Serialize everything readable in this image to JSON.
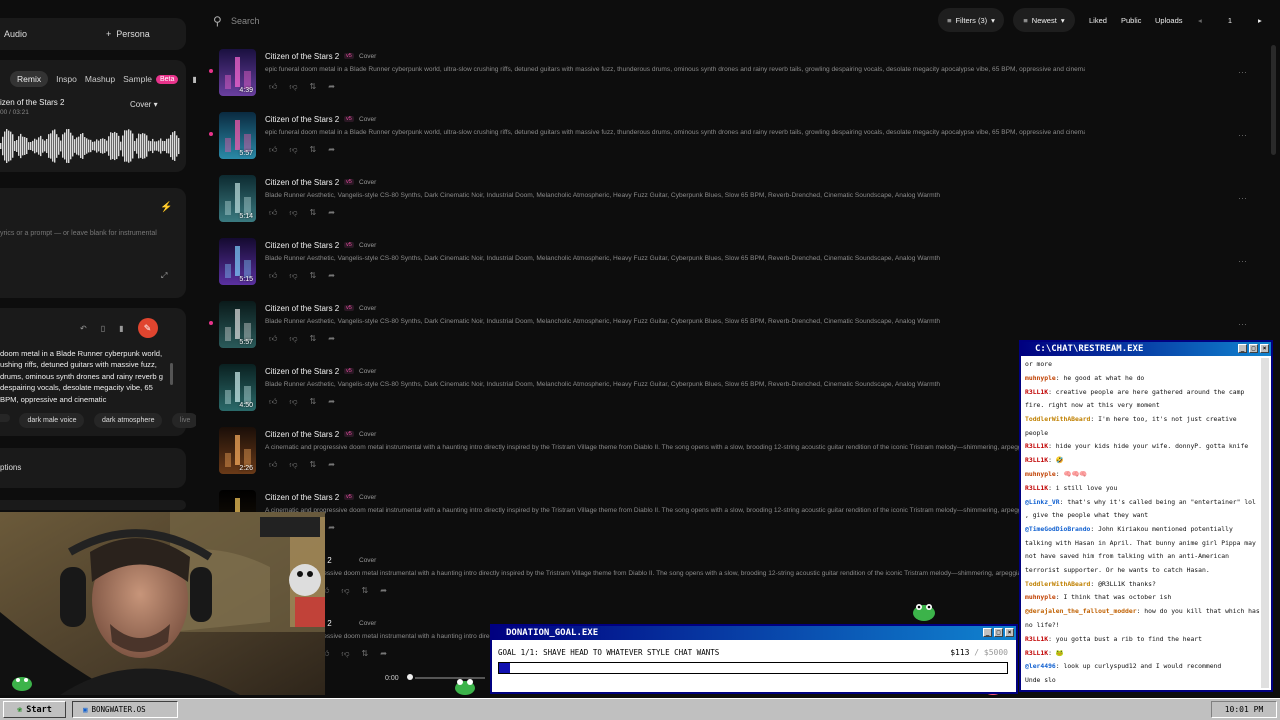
{
  "left": {
    "audio_label": "Audio",
    "persona_label": "Persona",
    "tabs": [
      "Remix",
      "Inspo",
      "Mashup",
      "Sample"
    ],
    "beta_label": "Beta",
    "track_title": "izen of the Stars 2",
    "track_time": "00 / 03:21",
    "cover_label": "Cover",
    "lyrics_placeholder": "yrics or a prompt — or leave blank for instrumental",
    "style_text": "doom metal in a Blade Runner cyberpunk world, ushing riffs, detuned guitars with massive fuzz, drums, ominous synth drones and rainy reverb g despairing vocals, desolate megacity vibe, 65 BPM, oppressive and cinematic",
    "tags": [
      "dark male voice",
      "dark atmosphere",
      "live"
    ],
    "options_label": "ptions"
  },
  "topbar": {
    "search_placeholder": "Search",
    "filters_label": "Filters (3)",
    "newest_label": "Newest",
    "liked_label": "Liked",
    "public_label": "Public",
    "uploads_label": "Uploads",
    "page_number": "1"
  },
  "songs": [
    {
      "title": "Citizen of the Stars 2",
      "badge": "v5",
      "kind": "Cover",
      "duration": "4:39",
      "new": true,
      "thumb": "neon-tower",
      "desc": "epic funeral doom metal in a Blade Runner cyberpunk world, ultra-slow crushing riffs, detuned guitars with massive fuzz, thunderous drums, ominous synth drones and rainy reverb tails, growling despairing vocals, desolate megacity apocalypse vibe, 65 BPM, oppressive and cinematic"
    },
    {
      "title": "Citizen of the Stars 2",
      "badge": "v5",
      "kind": "Cover",
      "duration": "5:57",
      "new": true,
      "thumb": "neon-city",
      "desc": "epic funeral doom metal in a Blade Runner cyberpunk world, ultra-slow crushing riffs, detuned guitars with massive fuzz, thunderous drums, ominous synth drones and rainy reverb tails, growling despairing vocals, desolate megacity apocalypse vibe, 65 BPM, oppressive and cinematic"
    },
    {
      "title": "Citizen of the Stars 2",
      "badge": "v5",
      "kind": "Cover",
      "duration": "5:14",
      "new": false,
      "thumb": "teal-city",
      "desc": "Blade Runner Aesthetic, Vangelis-style CS-80 Synths, Dark Cinematic Noir, Industrial Doom, Melancholic Atmospheric, Heavy Fuzz Guitar, Cyberpunk Blues, Slow 65 BPM, Reverb-Drenched, Cinematic Soundscape, Analog Warmth"
    },
    {
      "title": "Citizen of the Stars 2",
      "badge": "v5",
      "kind": "Cover",
      "duration": "5:15",
      "new": false,
      "thumb": "purple-night",
      "desc": "Blade Runner Aesthetic, Vangelis-style CS-80 Synths, Dark Cinematic Noir, Industrial Doom, Melancholic Atmospheric, Heavy Fuzz Guitar, Cyberpunk Blues, Slow 65 BPM, Reverb-Drenched, Cinematic Soundscape, Analog Warmth"
    },
    {
      "title": "Citizen of the Stars 2",
      "badge": "v5",
      "kind": "Cover",
      "duration": "5:57",
      "new": true,
      "thumb": "spinner",
      "desc": "Blade Runner Aesthetic, Vangelis-style CS-80 Synths, Dark Cinematic Noir, Industrial Doom, Melancholic Atmospheric, Heavy Fuzz Guitar, Cyberpunk Blues, Slow 65 BPM, Reverb-Drenched, Cinematic Soundscape, Analog Warmth"
    },
    {
      "title": "Citizen of the Stars 2",
      "badge": "v5",
      "kind": "Cover",
      "duration": "4:50",
      "new": false,
      "thumb": "spinner-teal",
      "desc": "Blade Runner Aesthetic, Vangelis-style CS-80 Synths, Dark Cinematic Noir, Industrial Doom, Melancholic Atmospheric, Heavy Fuzz Guitar, Cyberpunk Blues, Slow 65 BPM, Reverb-Drenched, Cinematic Soundscape, Analog Warmth"
    },
    {
      "title": "Citizen of the Stars 2",
      "badge": "v5",
      "kind": "Cover",
      "duration": "2:26",
      "new": false,
      "thumb": "cathedral",
      "desc": "A cinematic and progressive doom metal instrumental with a haunting intro directly inspired by the Tristram Village theme from Diablo II. The song opens with a slow, brooding 12-string acoustic guitar rendition of the iconic Tristram melody—shimmering, arpeggiate"
    },
    {
      "title": "Citizen of the Stars 2",
      "badge": "v5",
      "kind": "Cover",
      "duration": "",
      "new": false,
      "thumb": "candles",
      "desc": "A cinematic and progressive doom metal instrumental with a haunting intro directly inspired by the Tristram Village theme from Diablo II. The song opens with a slow, brooding 12-string acoustic guitar rendition of the iconic Tristram melody—shimmering, arpeggiate"
    },
    {
      "title": "s 2",
      "badge": "",
      "kind": "Cover",
      "duration": "",
      "new": false,
      "thumb": "",
      "desc": "ressive doom metal instrumental with a haunting intro directly inspired by the Tristram Village theme from Diablo II. The song opens with a slow, brooding 12-string acoustic guitar rendition of the iconic Tristram melody—shimmering, arpeggiate"
    },
    {
      "title": "s 2",
      "badge": "",
      "kind": "Cover",
      "duration": "",
      "new": false,
      "thumb": "",
      "desc": "ressive doom metal instrumental with a haunting intro directly inspired by the Tristram Village theme from Diablo II. The song opens with a slow, brooding 12-string acoustic guitar rendition"
    }
  ],
  "chat": {
    "title": "C:\\CHAT\\RESTREAM.EXE",
    "messages": [
      {
        "user": "",
        "color": "#000",
        "text": "or more"
      },
      {
        "user": "muhnyple",
        "color": "#c04000",
        "text": "he good at what he do"
      },
      {
        "user": "R3LL1K",
        "color": "#c00000",
        "text": "creative people are here gathered around the camp fire. right now at this very moment"
      },
      {
        "user": "ToddlerWithABeard",
        "color": "#c08000",
        "text": "I'm here too, it's not just creative people"
      },
      {
        "user": "R3LL1K",
        "color": "#c00000",
        "text": "hide your kids hide your wife. donnyP. gotta knife"
      },
      {
        "user": "R3LL1K",
        "color": "#c00000",
        "text": "🤣"
      },
      {
        "user": "muhnyple",
        "color": "#c04000",
        "text": "🧠🧠🧠"
      },
      {
        "user": "R3LL1K",
        "color": "#c00000",
        "text": "i still love you"
      },
      {
        "user": "@Linkz_VR",
        "color": "#1060d0",
        "text": "that's why it's called being an \"entertainer\" lol , give the people what they want"
      },
      {
        "user": "@TimeGodDioBrando",
        "color": "#1060d0",
        "text": "John Kiriakou mentioned potentially talking with Hasan in April. That bunny anime girl Pippa may not have saved him from talking with an anti-American terrorist supporter. Or he wants to catch Hasan."
      },
      {
        "user": "ToddlerWithABeard",
        "color": "#c08000",
        "text": "@R3LL1K thanks?"
      },
      {
        "user": "muhnyple",
        "color": "#c04000",
        "text": "I think that was october ish"
      },
      {
        "user": "@derajalen_the_fallout_modder",
        "color": "#c06000",
        "text": "how do you kill that which has no life?!"
      },
      {
        "user": "R3LL1K",
        "color": "#c00000",
        "text": "you gotta bust a rib to find the heart"
      },
      {
        "user": "R3LL1K",
        "color": "#c00000",
        "text": "🐸"
      },
      {
        "user": "@ler4496",
        "color": "#1060d0",
        "text": "look up curlyspud12 and I would recommend"
      },
      {
        "user": "",
        "color": "#000",
        "text": "Unde      slo"
      }
    ]
  },
  "donation": {
    "title": "DONATION_GOAL.EXE",
    "goal_text": "GOAL 1/1: SHAVE HEAD TO WHATEVER STYLE CHAT WANTS",
    "current": "$113",
    "total": "/ $5000",
    "progress_fraction": 0.0226
  },
  "taskbar": {
    "start_label": "Start",
    "app_label": "BONGWATER.OS",
    "clock": "10:01 PM"
  },
  "player": {
    "time": "0:00"
  },
  "colors": {
    "accent": "#e8338b",
    "bg": "#0d0d0d",
    "win_title": "#000080"
  }
}
